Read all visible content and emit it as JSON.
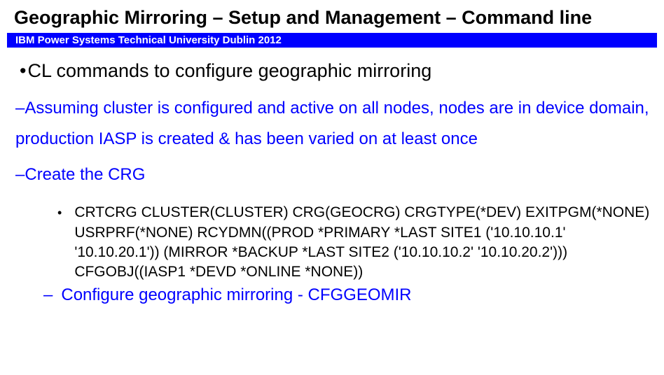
{
  "title": "Geographic Mirroring – Setup and Management – Command line",
  "banner": "IBM Power Systems Technical  University Dublin 2012",
  "main": {
    "heading": "CL commands to configure geographic mirroring",
    "assumption": "Assuming cluster is configured and active on all nodes, nodes are in device domain, production IASP is created & has been varied on at least once",
    "create_crg_label": "Create the CRG",
    "command": "CRTCRG CLUSTER(CLUSTER) CRG(GEOCRG) CRGTYPE(*DEV) EXITPGM(*NONE) USRPRF(*NONE) RCYDMN((PROD *PRIMARY *LAST SITE1 ('10.10.10.1' '10.10.20.1')) (MIRROR *BACKUP *LAST SITE2 ('10.10.10.2' '10.10.20.2'))) CFGOBJ((IASP1 *DEVD *ONLINE *NONE))",
    "configure_label": "Configure geographic mirroring - CFGGEOMIR"
  }
}
